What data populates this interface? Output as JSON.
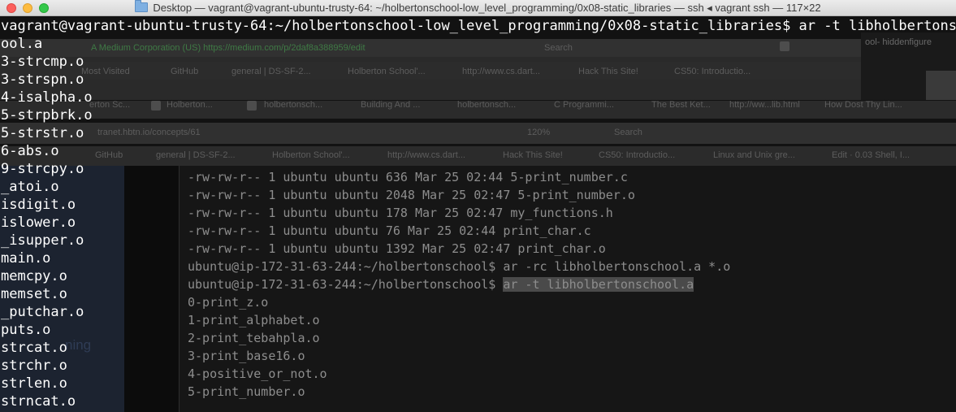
{
  "window": {
    "title": "Desktop — vagrant@vagrant-ubuntu-trusty-64: ~/holbertonschool-low_level_programming/0x08-static_libraries — ssh ◂ vagrant ssh — 117×22"
  },
  "terminal": {
    "prompt_line": "vagrant@vagrant-ubuntu-trusty-64:~/holbertonschool-low_level_programming/0x08-static_libraries$ ar -t libholbertonsch",
    "lines": [
      "ool.a",
      "3-strcmp.o",
      "3-strspn.o",
      "4-isalpha.o",
      "5-strpbrk.o",
      "5-strstr.o",
      "6-abs.o",
      "9-strcpy.o",
      "_atoi.o",
      "isdigit.o",
      "islower.o",
      "_isupper.o",
      "main.o",
      "memcpy.o",
      "memset.o",
      "_putchar.o",
      "puts.o",
      "strcat.o",
      "strchr.o",
      "strlen.o",
      "strncat.o"
    ]
  },
  "background_screenshot": {
    "url_bar_1": "A Medium Corporation (US)  https://medium.com/p/2daf8a388959/edit",
    "search_1": "Search",
    "bookmarks_1": [
      "Most Visited",
      "GitHub",
      "general | DS-SF-2...",
      "Holberton School'...",
      "http://www.cs.dart...",
      "Hack This Site!",
      "CS50: Introductio..."
    ],
    "right_text": "ool-  hiddenfigure",
    "tabs": [
      "erton Sc...",
      "Holberton...",
      "holbertonsch...",
      "Building And ...",
      "holbertonsch...",
      "C Programmi...",
      "The Best Ket...",
      "http://ww...lib.html",
      "How Dost Thy Lin..."
    ],
    "url_bar_2": "tranet.hbtn.io/concepts/61",
    "zoom": "120%",
    "search_2": "Search",
    "bookmarks_2": [
      "GitHub",
      "general | DS-SF-2...",
      "Holberton School'...",
      "http://www.cs.dart...",
      "Hack This Site!",
      "CS50: Introductio...",
      "Linux and Unix gre...",
      "Edit · 0.03 Shell, I..."
    ],
    "left_text": "ning",
    "code_lines": [
      "-rw-rw-r-- 1 ubuntu ubuntu 636 Mar 25 02:44 5-print_number.c",
      "-rw-rw-r-- 1 ubuntu ubuntu 2048 Mar 25 02:47 5-print_number.o",
      "-rw-rw-r-- 1 ubuntu ubuntu 178 Mar 25 02:47 my_functions.h",
      "-rw-rw-r-- 1 ubuntu ubuntu 76 Mar 25 02:44 print_char.c",
      "-rw-rw-r-- 1 ubuntu ubuntu 1392 Mar 25 02:47 print_char.o",
      "ubuntu@ip-172-31-63-244:~/holbertonschool$ ar -rc libholbertonschool.a *.o"
    ],
    "code_prompt": "ubuntu@ip-172-31-63-244:~/holbertonschool$ ",
    "code_cmd": "ar -t libholbertonschool.a",
    "code_output": [
      "0-print_z.o",
      "1-print_alphabet.o",
      "2-print_tebahpla.o",
      "3-print_base16.o",
      "4-positive_or_not.o",
      "5-print_number.o"
    ]
  }
}
